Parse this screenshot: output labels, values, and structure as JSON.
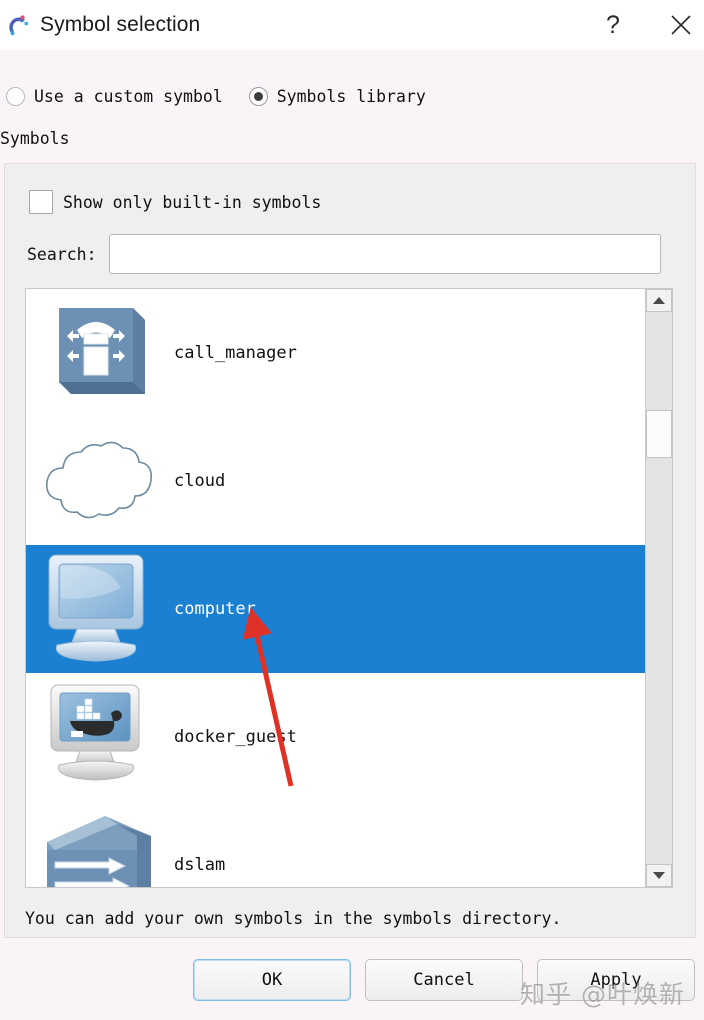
{
  "window": {
    "title": "Symbol selection",
    "app_icon": "gns3-logo-icon",
    "help_label": "?",
    "close_label": "✕"
  },
  "source_mode": {
    "options": [
      {
        "label": "Use a custom symbol",
        "selected": false
      },
      {
        "label": "Symbols library",
        "selected": true
      }
    ]
  },
  "section": {
    "caption": "Symbols"
  },
  "filters": {
    "builtin_checkbox_label": "Show only built-in symbols",
    "builtin_checked": false,
    "search_label": "Search:",
    "search_value": "",
    "search_placeholder": ""
  },
  "symbol_list": {
    "items": [
      {
        "name": "call_manager",
        "icon": "call-manager-icon",
        "selected": false
      },
      {
        "name": "cloud",
        "icon": "cloud-icon",
        "selected": false
      },
      {
        "name": "computer",
        "icon": "computer-icon",
        "selected": true
      },
      {
        "name": "docker_guest",
        "icon": "docker-guest-icon",
        "selected": false
      },
      {
        "name": "dslam",
        "icon": "dslam-icon",
        "selected": false
      }
    ],
    "scrollbar": {
      "up_arrow": "scroll-up-icon",
      "down_arrow": "scroll-down-icon"
    }
  },
  "hint": {
    "text": "You can add your own symbols in the symbols directory."
  },
  "buttons": {
    "ok": "OK",
    "cancel": "Cancel",
    "apply": "Apply"
  },
  "annotation": {
    "arrow_color": "#e03127",
    "points_at": "computer"
  },
  "watermark": {
    "text": "知乎 @叶焕新"
  },
  "colors": {
    "selection_blue": "#1b80d2",
    "dialog_background": "#faf4f8",
    "group_background": "#efefef",
    "title_background": "#ffffff"
  }
}
